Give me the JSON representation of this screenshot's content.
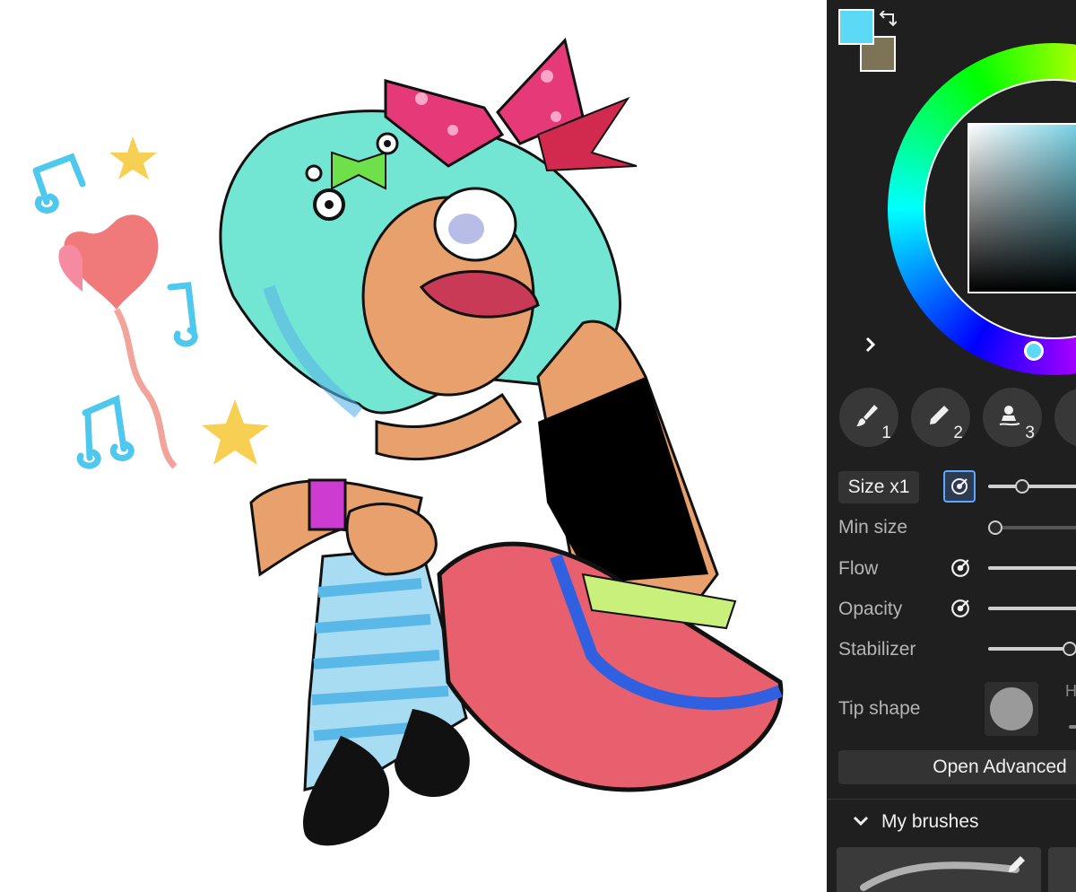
{
  "canvas": {
    "description_alt": ""
  },
  "panel": {
    "colors": {
      "primary": "#5cd9f5",
      "secondary": "#7d7458",
      "bg": "#1f1f1f",
      "accent": "#5aa8ff"
    },
    "tools": [
      {
        "name": "brush-icon",
        "number": "1"
      },
      {
        "name": "pencil-icon",
        "number": "2"
      },
      {
        "name": "smudge-icon",
        "number": "3"
      }
    ],
    "size_label": "Size x1",
    "min_size_label": "Min size",
    "flow_label": "Flow",
    "opacity_label": "Opacity",
    "stabilizer_label": "Stabilizer",
    "tip_shape_label": "Tip shape",
    "tip_shape_h_label": "H",
    "open_advanced_label": "Open Advanced",
    "my_brushes_label": "My brushes",
    "expand_icon": "chevron-right-icon",
    "swap_icon": "swap-colors-icon"
  }
}
